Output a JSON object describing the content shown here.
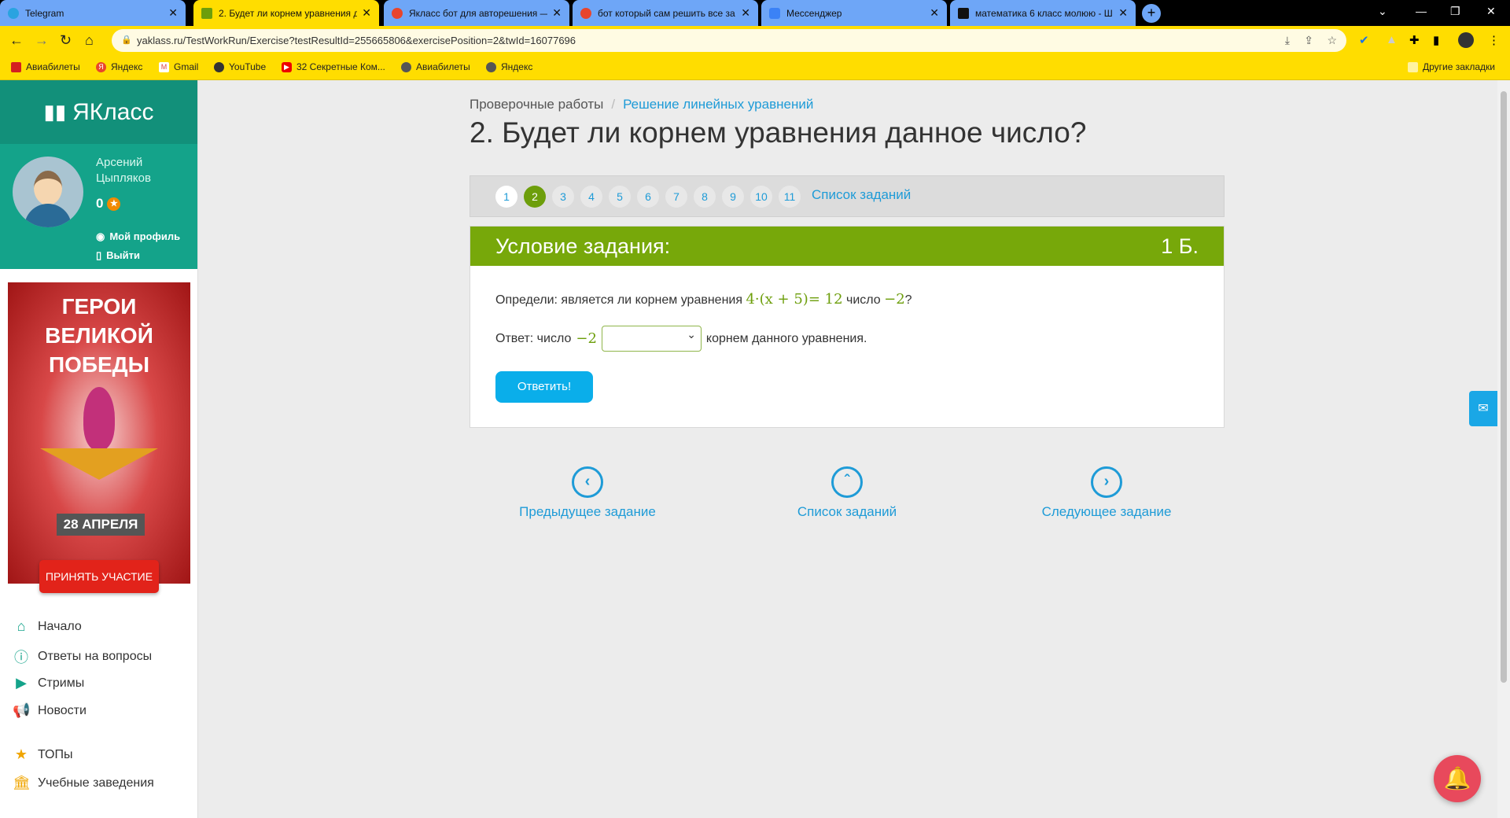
{
  "browser": {
    "tabs": [
      {
        "label": "Telegram",
        "icon": "telegram-icon",
        "color": "#2aa3e0"
      },
      {
        "label": "2. Будет ли корнем уравнения д",
        "icon": "yaklass-icon",
        "color": "#6d9e0b",
        "active": true
      },
      {
        "label": "Якласс бот для авторешения —",
        "icon": "yandex-icon",
        "color": "#e8452c"
      },
      {
        "label": "бот который сам решить все за",
        "icon": "yandex-icon",
        "color": "#e8452c"
      },
      {
        "label": "Мессенджер",
        "icon": "messenger-icon",
        "color": "#3b82f6"
      },
      {
        "label": "математика 6 класс молюю - Ш",
        "icon": "znanija-icon",
        "color": "#111"
      }
    ],
    "url": "yaklass.ru/TestWorkRun/Exercise?testResultId=255665806&exercisePosition=2&twId=16077696",
    "bookmarks": [
      "Авиабилеты",
      "Яндекс",
      "Gmail",
      "YouTube",
      "32 Секретные Ком...",
      "Авиабилеты",
      "Яндекс"
    ],
    "other_bookmarks": "Другие закладки"
  },
  "sidebar": {
    "logo": "ЯКласс",
    "user": {
      "first": "Арсений",
      "last": "Цыпляков",
      "points": "0",
      "profile": "Мой профиль",
      "logout": "Выйти"
    },
    "banner": {
      "title": "ГЕРОИ ВЕЛИКОЙ ПОБЕДЫ",
      "date": "28 АПРЕЛЯ",
      "cta": "ПРИНЯТЬ УЧАСТИЕ"
    },
    "menu": [
      {
        "label": "Начало",
        "icon": "home-icon"
      },
      {
        "label": "Ответы на вопросы",
        "icon": "question-icon"
      },
      {
        "label": "Стримы",
        "icon": "play-icon"
      },
      {
        "label": "Новости",
        "icon": "megaphone-icon"
      },
      {
        "label": "ТОПы",
        "icon": "star-icon"
      },
      {
        "label": "Учебные заведения",
        "icon": "institution-icon"
      }
    ]
  },
  "main": {
    "breadcrumb": [
      "Проверочные работы",
      "Решение линейных уравнений"
    ],
    "title": "2. Будет ли корнем уравнения данное число?",
    "pages": [
      "1",
      "2",
      "3",
      "4",
      "5",
      "6",
      "7",
      "8",
      "9",
      "10",
      "11"
    ],
    "current_page": "2",
    "task_list": "Список заданий",
    "card": {
      "header": "Условие задания:",
      "points": "1 Б.",
      "question_pre": "Определи: является ли корнем уравнения",
      "equation": "4·(x + 5)= 12",
      "question_mid": "число",
      "number": "−2",
      "question_end": "?",
      "answer_pre": "Ответ: число",
      "answer_number": "−2",
      "answer_select_value": "",
      "answer_post": "корнем данного уравнения.",
      "submit": "Ответить!"
    },
    "nav": {
      "prev": "Предыдущее задание",
      "list": "Список заданий",
      "next": "Следующее задание"
    }
  },
  "colors": {
    "accent_green": "#77a80a",
    "teal": "#14a38a",
    "link": "#1e9bd7",
    "button": "#0aaeea"
  }
}
